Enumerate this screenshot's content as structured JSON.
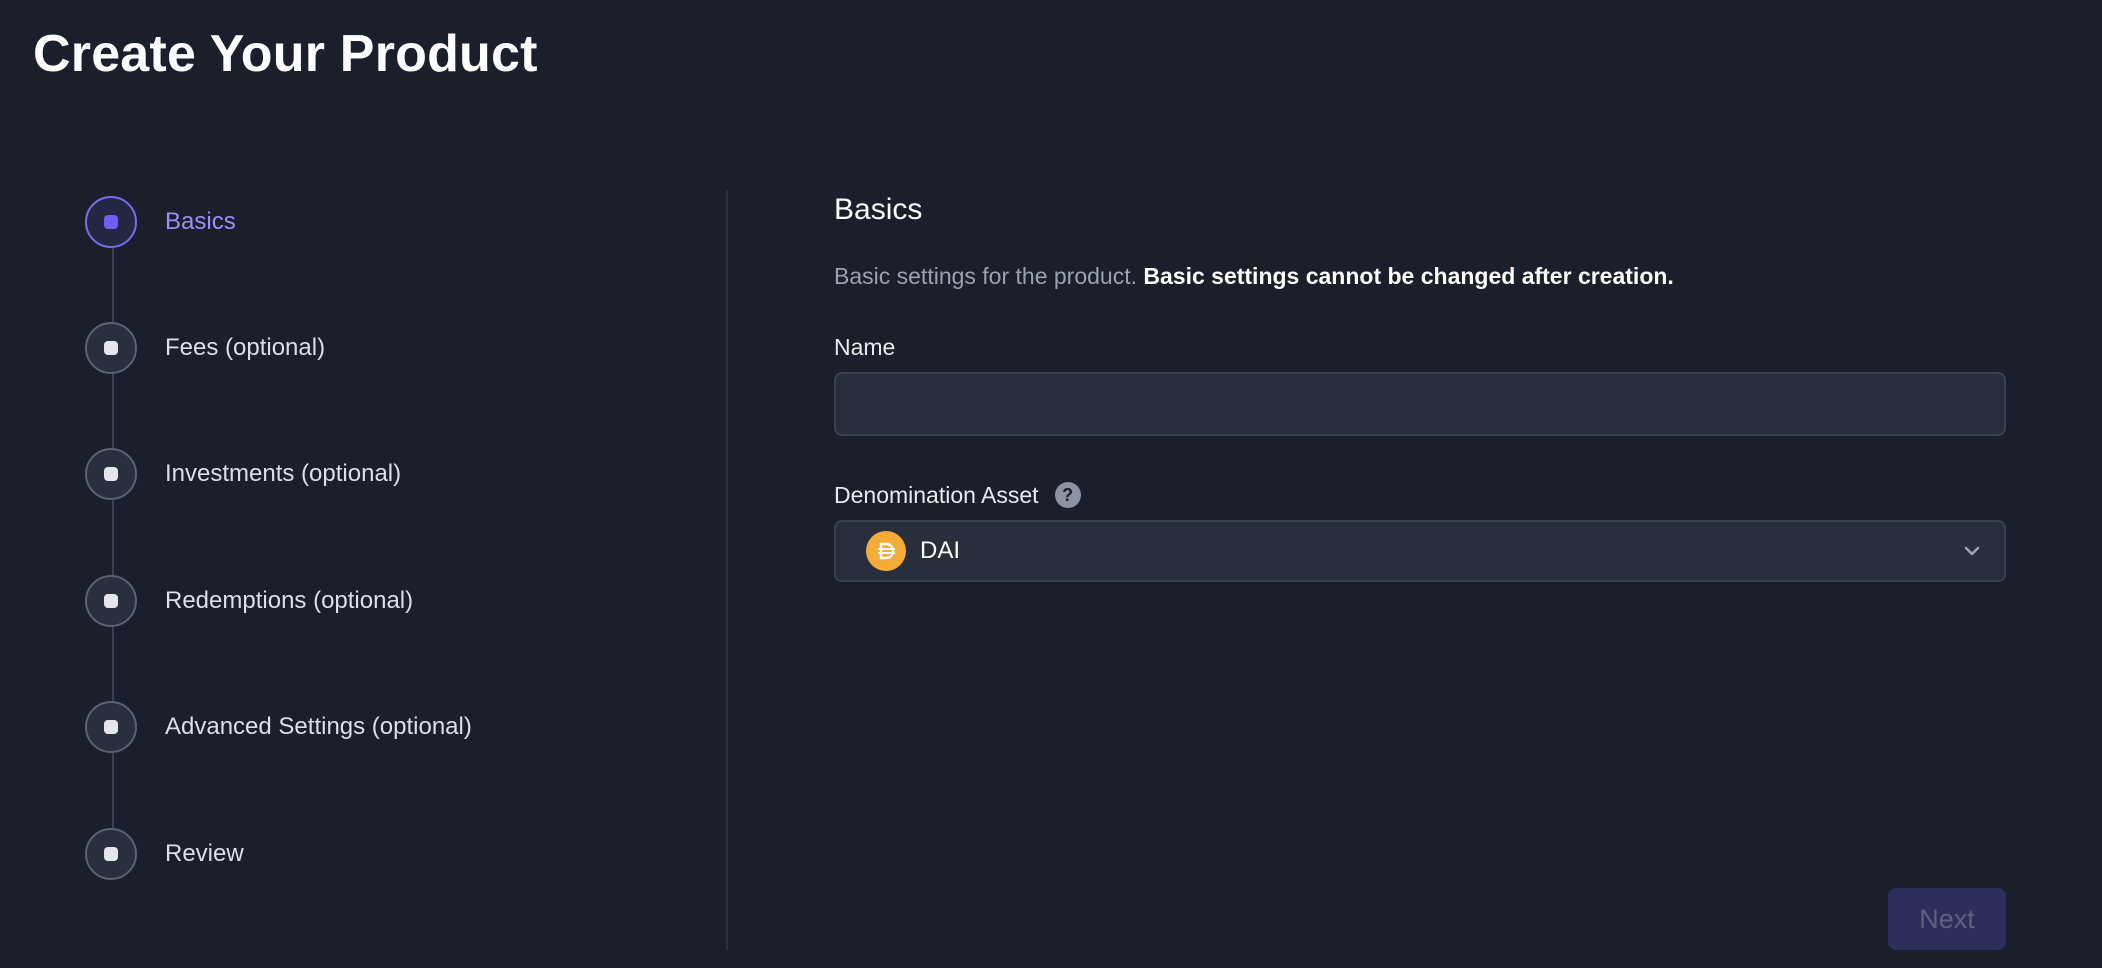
{
  "page": {
    "title": "Create Your Product"
  },
  "stepper": {
    "steps": [
      {
        "label": "Basics",
        "state": "active"
      },
      {
        "label": "Fees (optional)",
        "state": "pending"
      },
      {
        "label": "Investments (optional)",
        "state": "pending"
      },
      {
        "label": "Redemptions (optional)",
        "state": "pending"
      },
      {
        "label": "Advanced Settings (optional)",
        "state": "pending"
      },
      {
        "label": "Review",
        "state": "pending"
      }
    ]
  },
  "form": {
    "section_title": "Basics",
    "description": "Basic settings for the product.",
    "description_bold": "Basic settings cannot be changed after creation.",
    "name_label": "Name",
    "name_value": "",
    "name_placeholder": "",
    "asset_label": "Denomination Asset",
    "asset_help_icon": "question-mark",
    "asset_value": "DAI",
    "asset_icon": "dai-token-icon"
  },
  "actions": {
    "next_label": "Next"
  },
  "colors": {
    "background": "#1b1f2b",
    "accent": "#6d5ff1",
    "active_label": "#9d8ff6",
    "dai_token": "#f5ac37",
    "next_button_bg": "#2c2e5c"
  }
}
